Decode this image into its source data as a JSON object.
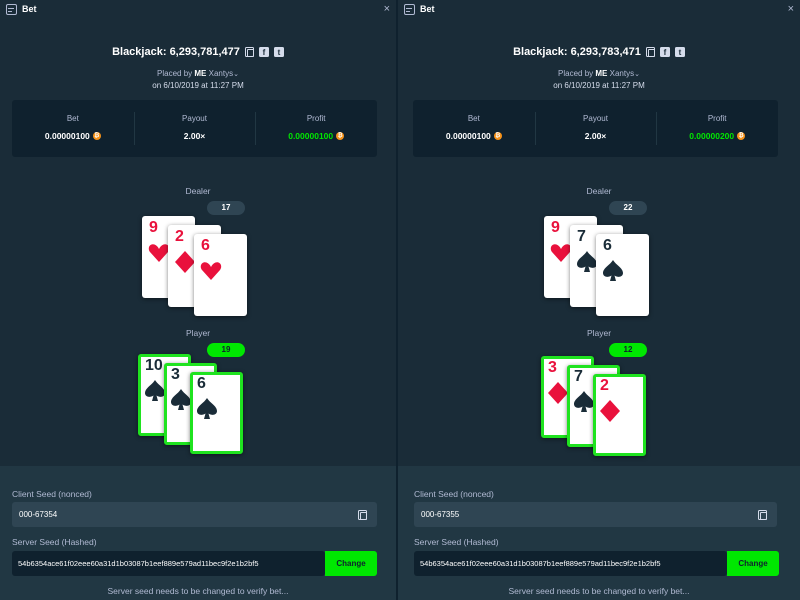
{
  "panels": [
    {
      "title": "Bet",
      "close": "×",
      "game_name": "Blackjack",
      "bet_id": "6,293,781,477",
      "placed_by_prefix": "Placed by",
      "user": "Xantys",
      "user_badge": "ME",
      "date": "on 6/10/2019 at 11:27 PM",
      "stats": [
        {
          "label": "Bet",
          "value": "0.00000100",
          "color": "#ffffff"
        },
        {
          "label": "Payout",
          "value": "2.00×",
          "color": "#ffffff"
        },
        {
          "label": "Profit",
          "value": "0.00000100",
          "color": "#00e701"
        }
      ],
      "dealer_label": "Dealer",
      "dealer_total": "17",
      "dealer_cards": [
        {
          "rank": "9",
          "suit": "hearts"
        },
        {
          "rank": "2",
          "suit": "diamonds"
        },
        {
          "rank": "6",
          "suit": "hearts"
        }
      ],
      "player_label": "Player",
      "player_total": "19",
      "player_cards": [
        {
          "rank": "10",
          "suit": "spades"
        },
        {
          "rank": "3",
          "suit": "spades"
        },
        {
          "rank": "6",
          "suit": "spades"
        }
      ],
      "client_seed_label": "Client Seed (nonced)",
      "client_seed": "000-67354",
      "server_seed_label": "Server Seed (Hashed)",
      "server_seed": "54b6354ace61f02eee60a31d1b03087b1eef889e579ad11bec9f2e1b2bf5",
      "change_label": "Change",
      "note": "Server seed needs to be changed to verify bet..."
    },
    {
      "title": "Bet",
      "close": "×",
      "game_name": "Blackjack",
      "bet_id": "6,293,783,471",
      "placed_by_prefix": "Placed by",
      "user": "Xantys",
      "user_badge": "ME",
      "date": "on 6/10/2019 at 11:27 PM",
      "stats": [
        {
          "label": "Bet",
          "value": "0.00000100",
          "color": "#ffffff"
        },
        {
          "label": "Payout",
          "value": "2.00×",
          "color": "#ffffff"
        },
        {
          "label": "Profit",
          "value": "0.00000200",
          "color": "#00e701"
        }
      ],
      "dealer_label": "Dealer",
      "dealer_total": "22",
      "dealer_cards": [
        {
          "rank": "9",
          "suit": "hearts"
        },
        {
          "rank": "7",
          "suit": "spades"
        },
        {
          "rank": "6",
          "suit": "spades"
        }
      ],
      "player_label": "Player",
      "player_total": "12",
      "player_cards": [
        {
          "rank": "3",
          "suit": "diamonds"
        },
        {
          "rank": "7",
          "suit": "spades"
        },
        {
          "rank": "2",
          "suit": "diamonds"
        }
      ],
      "client_seed_label": "Client Seed (nonced)",
      "client_seed": "000-67355",
      "server_seed_label": "Server Seed (Hashed)",
      "server_seed": "54b6354ace61f02eee60a31d1b03087b1eef889e579ad11bec9f2e1b2bf5",
      "change_label": "Change",
      "note": "Server seed needs to be changed to verify bet..."
    }
  ],
  "colors": {
    "background": "#1a2c38",
    "dark": "#0f212e",
    "win_green": "#00e701",
    "red_suit": "#e9113c",
    "black_suit": "#1a2c38",
    "muted_text": "#b1bad3"
  },
  "icons": [
    "bet-icon",
    "close-icon",
    "copy-icon",
    "facebook-icon",
    "twitter-icon",
    "chevron-down-icon",
    "coin-icon"
  ]
}
